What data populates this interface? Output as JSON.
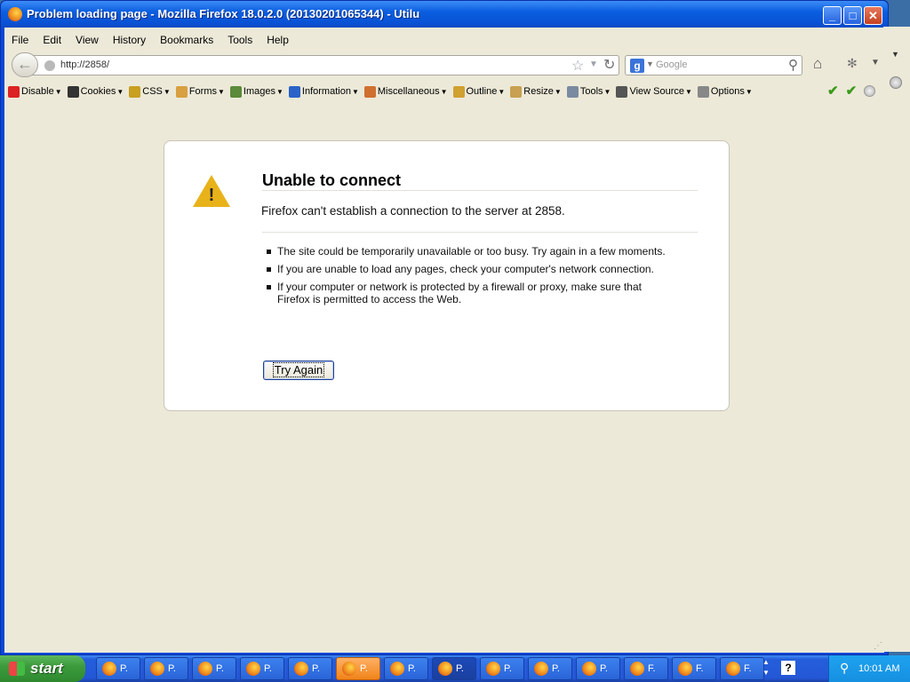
{
  "window": {
    "title": "Problem loading page - Mozilla Firefox 18.0.2.0 (20130201065344) - Utilu",
    "minimize": "_",
    "maximize": "□",
    "close": "✕"
  },
  "menu": [
    "File",
    "Edit",
    "View",
    "History",
    "Bookmarks",
    "Tools",
    "Help"
  ],
  "nav": {
    "back_glyph": "←",
    "url": "http://2858/",
    "search_placeholder": "Google",
    "search_engine_letter": "g"
  },
  "devtoolbar": [
    {
      "label": "Disable",
      "icon": "disable-icon",
      "color": "#d22"
    },
    {
      "label": "Cookies",
      "icon": "cookies-icon",
      "color": "#333"
    },
    {
      "label": "CSS",
      "icon": "css-icon",
      "color": "#c9a020"
    },
    {
      "label": "Forms",
      "icon": "forms-icon",
      "color": "#d8a040"
    },
    {
      "label": "Images",
      "icon": "images-icon",
      "color": "#5a8a3a"
    },
    {
      "label": "Information",
      "icon": "information-icon",
      "color": "#2b63c8"
    },
    {
      "label": "Miscellaneous",
      "icon": "miscellaneous-icon",
      "color": "#d07030"
    },
    {
      "label": "Outline",
      "icon": "outline-icon",
      "color": "#d0a030"
    },
    {
      "label": "Resize",
      "icon": "resize-icon",
      "color": "#c8a050"
    },
    {
      "label": "Tools",
      "icon": "tools-icon",
      "color": "#7a8aa0"
    },
    {
      "label": "View Source",
      "icon": "view-source-icon",
      "color": "#555"
    },
    {
      "label": "Options",
      "icon": "options-icon",
      "color": "#888"
    }
  ],
  "error": {
    "title": "Unable to connect",
    "short": "Firefox can't establish a connection to the server at 2858.",
    "bullets": [
      "The site could be temporarily unavailable or too busy. Try again in a few moments.",
      "If you are unable to load any pages, check your computer's network connection.",
      "If your computer or network is protected by a firewall or proxy, make sure that Firefox is permitted to access the Web."
    ],
    "try_again": "Try Again"
  },
  "taskbar": {
    "start": "start",
    "tasks": [
      "P.",
      "P.",
      "P.",
      "P.",
      "P.",
      "P.",
      "P.",
      "P.",
      "P.",
      "P.",
      "P.",
      "F.",
      "F.",
      "F."
    ],
    "clock": "10:01 AM"
  }
}
